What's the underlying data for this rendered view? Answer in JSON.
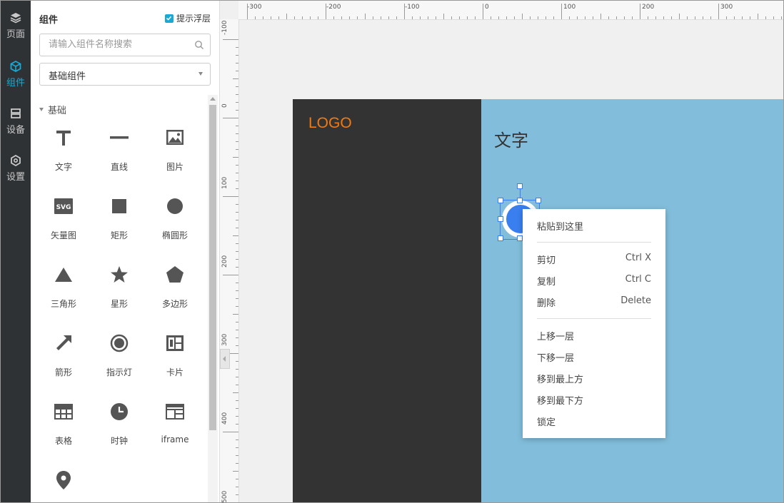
{
  "rail": [
    {
      "icon": "layers-icon",
      "label": "页面",
      "active": false
    },
    {
      "icon": "cube-icon",
      "label": "组件",
      "active": true
    },
    {
      "icon": "device-icon",
      "label": "设备",
      "active": false
    },
    {
      "icon": "settings-icon",
      "label": "设置",
      "active": false
    }
  ],
  "panel": {
    "title": "组件",
    "hint_label": "提示浮层",
    "hint_checked": true,
    "search_placeholder": "请输入组件名称搜索",
    "category_select": "基础组件",
    "section": "基础",
    "components": [
      {
        "icon": "text-icon",
        "label": "文字"
      },
      {
        "icon": "line-icon",
        "label": "直线"
      },
      {
        "icon": "image-icon",
        "label": "图片"
      },
      {
        "icon": "svg-icon",
        "label": "矢量图"
      },
      {
        "icon": "rectangle-icon",
        "label": "矩形"
      },
      {
        "icon": "ellipse-icon",
        "label": "椭圆形"
      },
      {
        "icon": "triangle-icon",
        "label": "三角形"
      },
      {
        "icon": "star-icon",
        "label": "星形"
      },
      {
        "icon": "polygon-icon",
        "label": "多边形"
      },
      {
        "icon": "arrow-icon",
        "label": "箭形"
      },
      {
        "icon": "indicator-icon",
        "label": "指示灯"
      },
      {
        "icon": "card-icon",
        "label": "卡片"
      },
      {
        "icon": "table-icon",
        "label": "表格"
      },
      {
        "icon": "clock-icon",
        "label": "时钟"
      },
      {
        "icon": "iframe-icon",
        "label": "iframe"
      },
      {
        "icon": "map-pin-icon",
        "label": ""
      }
    ]
  },
  "ruler": {
    "top": [
      "-300",
      "-200",
      "-100",
      "0",
      "100",
      "200",
      "300"
    ],
    "left": [
      "-100",
      "0",
      "100",
      "200",
      "300",
      "400",
      "500"
    ]
  },
  "canvas": {
    "logo_text": "LOGO",
    "text_element": "文字",
    "colors": {
      "dark_page": "#333333",
      "blue_page": "#82bedb",
      "logo": "#f47a0f",
      "circle": "#3a7ff0",
      "accent": "#19a9d5"
    }
  },
  "context_menu": {
    "paste": "粘贴到这里",
    "items": [
      {
        "label": "剪切",
        "shortcut": "Ctrl X"
      },
      {
        "label": "复制",
        "shortcut": "Ctrl C"
      },
      {
        "label": "删除",
        "shortcut": "Delete"
      }
    ],
    "layer_items": [
      "上移一层",
      "下移一层",
      "移到最上方",
      "移到最下方",
      "锁定"
    ]
  }
}
